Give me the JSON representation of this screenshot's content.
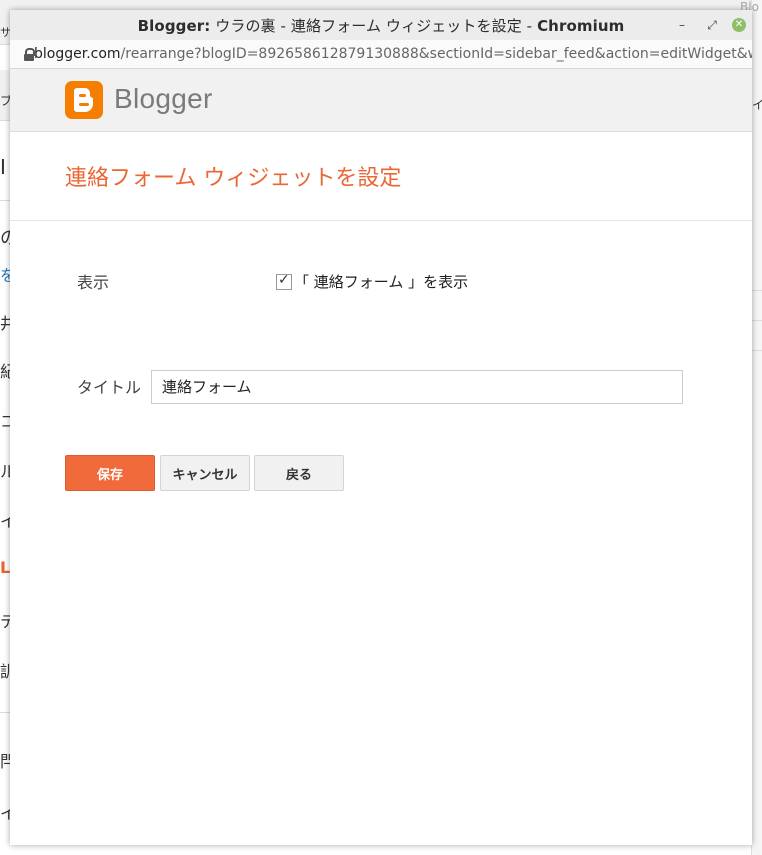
{
  "window": {
    "title_brand": "Blogger:",
    "title_middle": " ウラの裏 - 連絡フォーム ウィジェットを設定 - ",
    "title_app": "Chromium",
    "controls": {
      "minimize": "–",
      "restore": "⤢",
      "close": "✕"
    }
  },
  "urlbar": {
    "domain": "blogger.com",
    "path": "/rearrange?blogID=892658612879130888&sectionId=sidebar_feed&action=editWidget&widg..."
  },
  "header": {
    "logo_text": "Blogger",
    "logo_color": "#f57d00"
  },
  "page": {
    "title": "連絡フォーム ウィジェットを設定",
    "accent_color": "#ea6634"
  },
  "form": {
    "display_label": "表示",
    "show_checkbox_label": "「 連絡フォーム 」を表示",
    "show_checkbox_checked": true,
    "title_label": "タイトル",
    "title_value": "連絡フォーム"
  },
  "buttons": {
    "save": "保存",
    "cancel": "キャンセル",
    "back": "戻る"
  },
  "background": {
    "glyphs": [
      "サ",
      "ブ",
      "I",
      "の",
      "を",
      "井",
      "紀",
      "コ",
      "ル",
      "イ",
      "L",
      "テ",
      "訓",
      "閂",
      "イ",
      "Blo",
      "イ"
    ]
  }
}
